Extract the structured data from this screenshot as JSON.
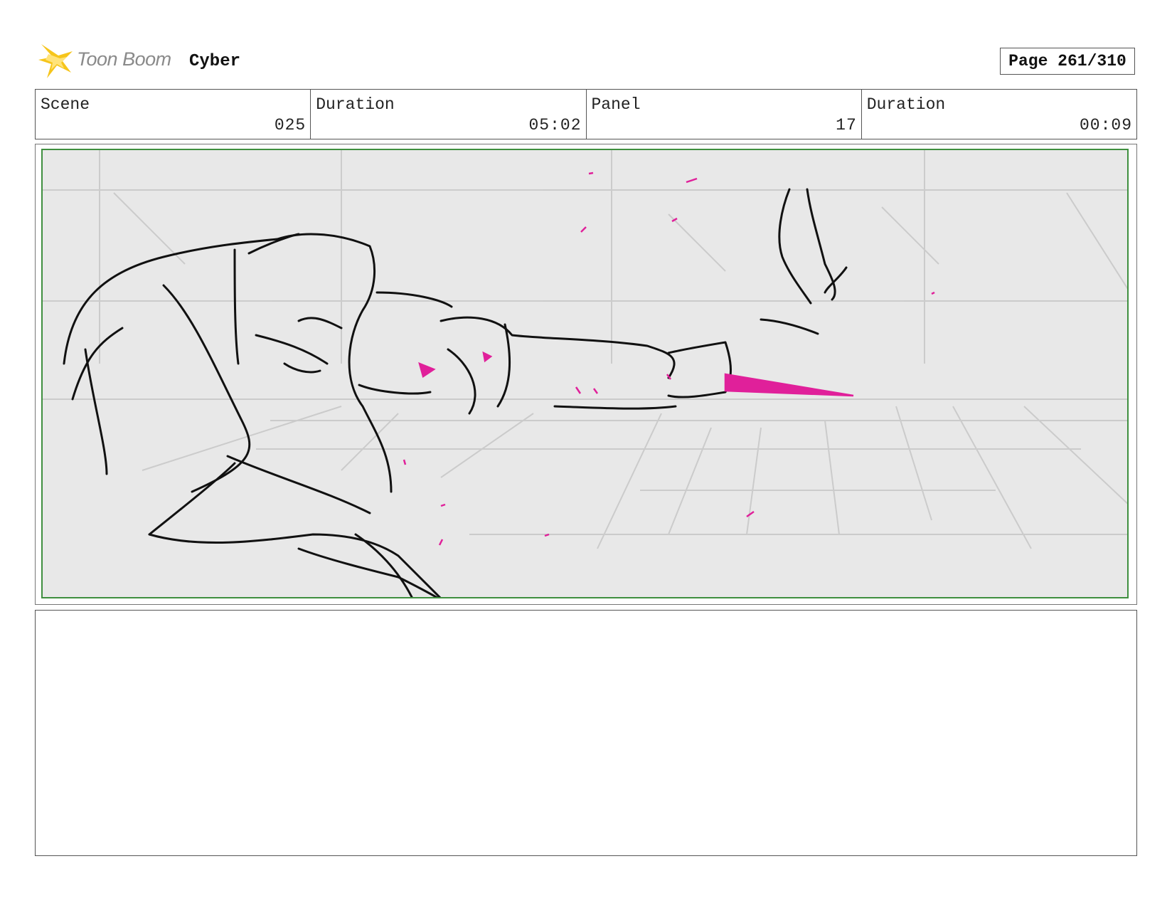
{
  "header": {
    "logo_text": "Toon Boom",
    "project_title": "Cyber",
    "page_label": "Page 261/310"
  },
  "info_row": [
    {
      "label": "Scene",
      "value": "025"
    },
    {
      "label": "Duration",
      "value": "05:02"
    },
    {
      "label": "Panel",
      "value": "17"
    },
    {
      "label": "Duration",
      "value": "00:09"
    }
  ],
  "panel": {
    "image_description_icon": "storyboard-sketch",
    "accent_color": "#e0209a",
    "frame_color": "#3f8f3f"
  },
  "notes": {
    "text": ""
  }
}
